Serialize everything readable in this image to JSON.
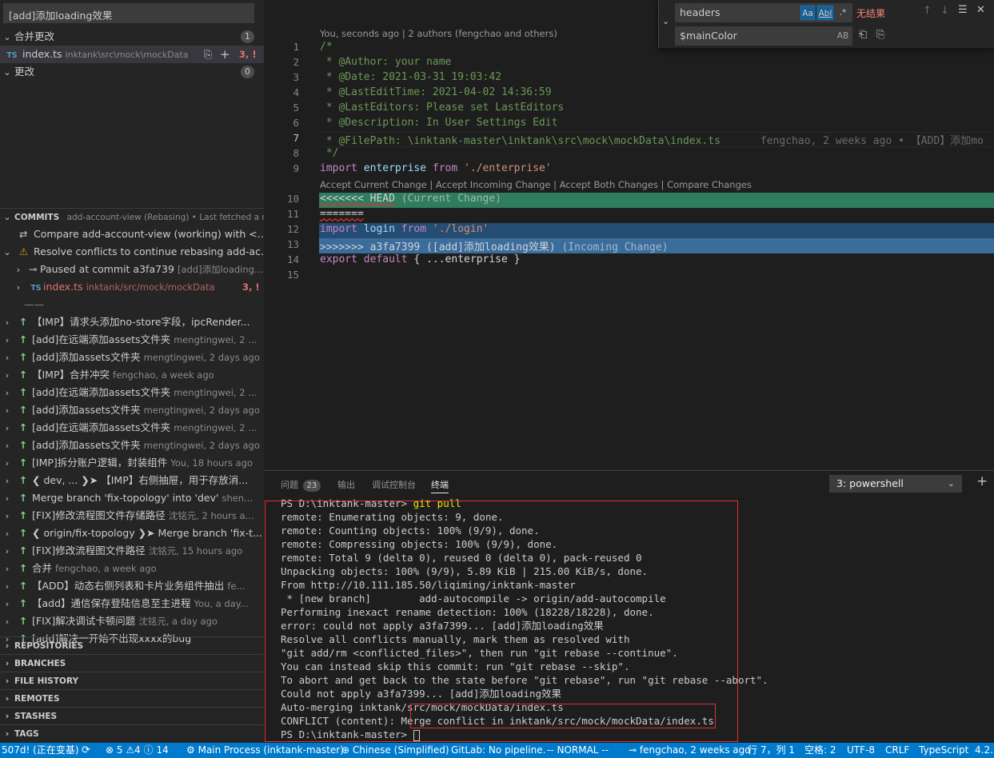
{
  "scm": {
    "commit_message": "[add]添加loading效果",
    "merge_changes": {
      "label": "合并更改",
      "count": "1"
    },
    "merge_file": {
      "name": "index.ts",
      "path": "inktank\\src\\mock\\mockData",
      "status": "3, !"
    },
    "changes": {
      "label": "更改",
      "count": "0"
    }
  },
  "commits": {
    "title": "COMMITS",
    "subtitle": "add-account-view (Rebasing) • Last fetched a minu...",
    "compare": "Compare add-account-view (working) with <...",
    "resolve": "Resolve conflicts to continue rebasing add-ac...",
    "paused": "Paused at commit a3fa739",
    "paused_meta": "[add]添加loading...",
    "conflict_file": {
      "name": "index.ts",
      "path": "inktank/src/mock/mockData",
      "status": "3, !"
    },
    "divider": "——",
    "items": [
      {
        "msg": "【IMP】请求头添加no-store字段，ipcRender...",
        "meta": ""
      },
      {
        "msg": "[add]在远端添加assets文件夹",
        "meta": "mengtingwei, 2 ..."
      },
      {
        "msg": "[add]添加assets文件夹",
        "meta": "mengtingwei, 2 days ago"
      },
      {
        "msg": "【IMP】合并冲突",
        "meta": "fengchao, a week ago"
      },
      {
        "msg": "[add]在远端添加assets文件夹",
        "meta": "mengtingwei, 2 ..."
      },
      {
        "msg": "[add]添加assets文件夹",
        "meta": "mengtingwei, 2 days ago"
      },
      {
        "msg": "[add]在远端添加assets文件夹",
        "meta": "mengtingwei, 2 ..."
      },
      {
        "msg": "[add]添加assets文件夹",
        "meta": "mengtingwei, 2 days ago"
      },
      {
        "msg": "[IMP]拆分账户逻辑，封装组件",
        "meta": "You, 18 hours ago"
      },
      {
        "msg": "❮ dev, ... ❯➤ 【IMP】右侧抽屉，用于存放消...",
        "meta": ""
      },
      {
        "msg": "Merge branch 'fix-topology' into 'dev'",
        "meta": "shen..."
      },
      {
        "msg": "[FIX]修改流程图文件存储路径",
        "meta": "沈铭元, 2 hours a..."
      },
      {
        "msg": "❮ origin/fix-topology ❯➤  Merge branch 'fix-t...",
        "meta": ""
      },
      {
        "msg": "[FIX]修改流程图文件路径",
        "meta": "沈铭元, 15 hours ago"
      },
      {
        "msg": "合并",
        "meta": "fengchao, a week ago"
      },
      {
        "msg": "【ADD】动态右侧列表和卡片业务组件抽出",
        "meta": "fe..."
      },
      {
        "msg": "【add】通信保存登陆信息至主进程",
        "meta": "You, a day..."
      },
      {
        "msg": "[FIX]解决调试卡顿问题",
        "meta": "沈铭元, a day ago"
      },
      {
        "msg": "[add]解决一开始不出现xxxx的bug",
        "meta": ""
      }
    ]
  },
  "sections": [
    "REPOSITORIES",
    "BRANCHES",
    "FILE HISTORY",
    "REMOTES",
    "STASHES",
    "TAGS"
  ],
  "editor": {
    "blame_header": "You, seconds ago | 2 authors (fengchao and others)",
    "code_lens": "Accept Current Change | Accept Incoming Change | Accept Both Changes | Compare Changes",
    "line_numbers": [
      "1",
      "2",
      "3",
      "4",
      "5",
      "6",
      "7",
      "8",
      "9",
      "10",
      "11",
      "12",
      "13",
      "14",
      "15"
    ],
    "lines": {
      "l1": "/*",
      "l2": " * @Author: your name",
      "l3": " * @Date: 2021-03-31 19:03:42",
      "l4": " * @LastEditTime: 2021-04-02 14:36:59",
      "l5": " * @LastEditors: Please set LastEditors",
      "l6": " * @Description: In User Settings Edit",
      "l7": " * @FilePath: \\inktank-master\\inktank\\src\\mock\\mockData\\index.ts",
      "l7_blame": "fengchao, 2 weeks ago • 【ADD】添加mo",
      "l8": " */",
      "l9_kw": "import",
      "l9_id": "enterprise",
      "l9_from": "from",
      "l9_str": "'./enterprise'",
      "l10_marker": "<<<<<<< HEAD",
      "l10_hint": "(Current Change)",
      "l11": "=======",
      "l12_kw": "import",
      "l12_id": "login",
      "l12_from": "from",
      "l12_str": "'./login'",
      "l13_marker": ">>>>>>> a3fa7399 ([add]添加loading效果)",
      "l13_hint": "(Incoming Change)",
      "l14_kw": "export",
      "l14_kw2": "default",
      "l14_rest": "{ ...enterprise }"
    }
  },
  "find": {
    "search_value": "headers",
    "replace_value": "$mainColor",
    "opt_case": "Aa",
    "opt_word": "Abl",
    "opt_regex": ".*",
    "opt_preserve": "AB",
    "no_results": "无结果"
  },
  "panel": {
    "tabs": {
      "problems": "问题",
      "problems_count": "23",
      "output": "输出",
      "debug": "调试控制台",
      "terminal": "终端"
    },
    "terminal_select": "3: powershell",
    "terminal_lines": [
      "PS D:\\inktank-master> git pull",
      "remote: Enumerating objects: 9, done.",
      "remote: Counting objects: 100% (9/9), done.",
      "remote: Compressing objects: 100% (9/9), done.",
      "remote: Total 9 (delta 0), reused 0 (delta 0), pack-reused 0",
      "Unpacking objects: 100% (9/9), 5.89 KiB | 215.00 KiB/s, done.",
      "From http://10.111.185.50/liqiming/inktank-master",
      " * [new branch]        add-autocompile -> origin/add-autocompile",
      "Performing inexact rename detection: 100% (18228/18228), done.",
      "error: could not apply a3fa7399... [add]添加loading效果",
      "Resolve all conflicts manually, mark them as resolved with",
      "\"git add/rm <conflicted_files>\", then run \"git rebase --continue\".",
      "You can instead skip this commit: run \"git rebase --skip\".",
      "To abort and get back to the state before \"git rebase\", run \"git rebase --abort\".",
      "Could not apply a3fa7399... [add]添加loading效果",
      "Auto-merging inktank/src/mock/mockData/index.ts",
      "CONFLICT (content): Merge conflict in inktank/src/mock/mockData/index.ts",
      "PS D:\\inktank-master> "
    ]
  },
  "status": {
    "branch": "507d! (正在变基)",
    "errors": "5",
    "warnings": "4",
    "infos": "14",
    "process": "Main Process (inktank-master)",
    "language": "Chinese (Simplified)",
    "gitlab": "GitLab: No pipeline.",
    "vim": "-- NORMAL --",
    "blame": "fengchao, 2 weeks ago",
    "position": "行 7，列 1",
    "spaces": "空格: 2",
    "encoding": "UTF-8",
    "eol": "CRLF",
    "lang": "TypeScript",
    "version": "4.2.3"
  },
  "colors": {
    "status_bar": "#007acc",
    "current_change": "#2f7c5f",
    "incoming_change": "#3a6c9c",
    "conflict_text": "#e2716b",
    "terminal_highlight_border": "#e03131"
  }
}
